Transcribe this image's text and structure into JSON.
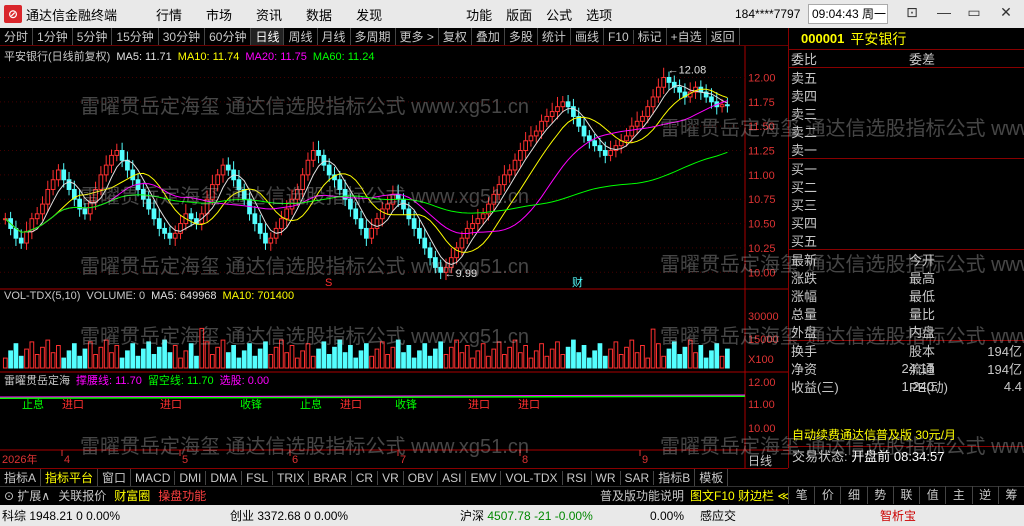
{
  "titlebar": {
    "app_name": "通达信金融终端",
    "menu": [
      "行情",
      "市场",
      "资讯",
      "数据",
      "发现"
    ],
    "menu2": [
      "功能",
      "版面",
      "公式",
      "选项"
    ],
    "user": "184****7797",
    "clock": "09:04:43 周一",
    "win_btns": [
      "⊡",
      "—",
      "▭",
      "✕"
    ]
  },
  "toolbar": {
    "items": [
      "分时",
      "1分钟",
      "5分钟",
      "15分钟",
      "30分钟",
      "60分钟",
      "日线",
      "周线",
      "月线",
      "多周期",
      "更多 >",
      "复权",
      "叠加",
      "多股",
      "统计",
      "画线",
      "F10",
      "标记",
      "+自选",
      "返回"
    ],
    "active": "日线"
  },
  "main_legend": {
    "title": "平安银行(日线前复权)",
    "items": [
      {
        "text": "MA5: 11.71",
        "color": "#e0e0e0"
      },
      {
        "text": "MA10: 11.74",
        "color": "#ffff00"
      },
      {
        "text": "MA20: 11.75",
        "color": "#ff00ff"
      },
      {
        "text": "MA60: 11.24",
        "color": "#00ff00"
      }
    ]
  },
  "vol_legend": {
    "title": "VOL-TDX(5,10)",
    "items": [
      {
        "text": "VOLUME: 0",
        "color": "#c8c8c8"
      },
      {
        "text": "MA5: 649968",
        "color": "#e0e0e0"
      },
      {
        "text": "MA10: 701400",
        "color": "#ffff00"
      }
    ]
  },
  "ind_legend": {
    "title": "雷曜贯岳定海",
    "items": [
      {
        "text": "撑腰线: 11.70",
        "color": "#ff00ff"
      },
      {
        "text": "留空线: 11.70",
        "color": "#00ff00"
      },
      {
        "text": "选股: 0.00",
        "color": "#ff00ff"
      }
    ]
  },
  "price_axis": [
    "12.00",
    "11.75",
    "11.50",
    "11.25",
    "11.00",
    "10.75",
    "10.50",
    "10.25",
    "10.00"
  ],
  "vol_axis": [
    "30000",
    "15000",
    "X100"
  ],
  "ind_axis": [
    "12.00",
    "11.00",
    "10.00"
  ],
  "annotations": {
    "high": "12.08",
    "low": "9.99",
    "s_mark": "S",
    "cai_mark": "财"
  },
  "date_axis": {
    "year": "2026年",
    "months": [
      "4",
      "5",
      "6",
      "7",
      "8",
      "9"
    ]
  },
  "ind_signals": {
    "zhi_xi": "止息",
    "jin_kou": "进口",
    "shou_feng": "收锋"
  },
  "chart_data": {
    "type": "candlestick",
    "title": "平安银行(日线前复权)",
    "ylim": [
      9.9,
      12.2
    ],
    "close": [
      10.55,
      10.45,
      10.35,
      10.3,
      10.42,
      10.55,
      10.6,
      10.7,
      10.85,
      10.95,
      11.05,
      10.95,
      10.85,
      10.75,
      10.65,
      10.6,
      10.72,
      10.85,
      11.0,
      11.1,
      11.2,
      11.25,
      11.15,
      11.05,
      10.95,
      10.85,
      10.75,
      10.65,
      10.55,
      10.45,
      10.4,
      10.35,
      10.4,
      10.5,
      10.6,
      10.55,
      10.5,
      10.6,
      10.75,
      10.9,
      11.0,
      11.1,
      11.05,
      10.95,
      10.85,
      10.75,
      10.6,
      10.5,
      10.4,
      10.3,
      10.35,
      10.45,
      10.55,
      10.65,
      10.75,
      10.85,
      11.0,
      11.15,
      11.25,
      11.2,
      11.1,
      11.0,
      10.95,
      10.85,
      10.75,
      10.65,
      10.55,
      10.45,
      10.35,
      10.45,
      10.55,
      10.65,
      10.7,
      10.8,
      10.75,
      10.65,
      10.55,
      10.45,
      10.35,
      10.25,
      10.15,
      10.05,
      10.0,
      10.05,
      10.15,
      10.25,
      10.35,
      10.45,
      10.5,
      10.55,
      10.6,
      10.7,
      10.8,
      10.9,
      11.0,
      11.05,
      11.15,
      11.25,
      11.35,
      11.4,
      11.45,
      11.55,
      11.6,
      11.65,
      11.7,
      11.75,
      11.7,
      11.6,
      11.5,
      11.4,
      11.35,
      11.3,
      11.25,
      11.2,
      11.25,
      11.3,
      11.35,
      11.4,
      11.5,
      11.55,
      11.6,
      11.7,
      11.8,
      11.9,
      12.0,
      11.95,
      11.9,
      11.85,
      11.8,
      11.85,
      11.9,
      11.85,
      11.8,
      11.75,
      11.7,
      11.72,
      11.71
    ],
    "vol_ma5_last": 649968,
    "vol_ma10_last": 701400
  },
  "right_panel": {
    "code": "000001",
    "name": "平安银行",
    "row1": {
      "lbl": "委比",
      "lbl2": "委差"
    },
    "sell": [
      "卖五",
      "卖四",
      "卖三",
      "卖二",
      "卖一"
    ],
    "buy": [
      "买一",
      "买二",
      "买三",
      "买四",
      "买五"
    ],
    "info": [
      {
        "l": "最新",
        "l2": "今开"
      },
      {
        "l": "涨跌",
        "l2": "最高"
      },
      {
        "l": "涨幅",
        "l2": "最低"
      },
      {
        "l": "总量",
        "l2": "量比"
      },
      {
        "l": "外盘",
        "l2": "内盘"
      }
    ],
    "fin": [
      {
        "l": "换手",
        "l2": "股本",
        "v2": "194亿"
      },
      {
        "l": "净资",
        "v": "24.13",
        "l2": "流通",
        "v2": "194亿"
      },
      {
        "l": "收益(三)",
        "v": "1.240",
        "l2": "PE(动)",
        "v2": "4.4"
      }
    ],
    "ad": "自动续费通达信普及版 30元/月",
    "status_label": "交易状态:",
    "status_value": "开盘前 08:34:57",
    "buttons": [
      "笔",
      "价",
      "细",
      "势",
      "联",
      "值",
      "主",
      "逆",
      "筹"
    ]
  },
  "tabs1": {
    "items": [
      "指标A",
      "指标平台",
      "窗口",
      "MACD",
      "DMI",
      "DMA",
      "FSL",
      "TRIX",
      "BRAR",
      "CR",
      "VR",
      "OBV",
      "ASI",
      "EMV",
      "VOL-TDX",
      "RSI",
      "WR",
      "SAR",
      "指标B",
      "模板"
    ],
    "active": "指标平台",
    "right_tab": "日线"
  },
  "tabs2": {
    "expand": "扩展∧",
    "items": [
      {
        "text": "关联报价",
        "color": "#c8c8c8"
      },
      {
        "text": "财富圈",
        "color": "#ffff00"
      },
      {
        "text": "操盘功能",
        "color": "#ff4040"
      }
    ],
    "right": "普及版功能说明",
    "f10": "图文F10 财边栏 ≪"
  },
  "statusbar": {
    "items": [
      {
        "name": "科综",
        "value": "1948.21",
        "chg": "0",
        "pct": "0.00%"
      },
      {
        "name": "创业",
        "value": "3372.68",
        "chg": "0",
        "pct": "0.00%"
      },
      {
        "name": "沪深",
        "value": "4507.78",
        "chg": "-21",
        "pct": "-0.00%"
      }
    ],
    "extra": "0.00%",
    "zhike": "智析宝",
    "right": "感应交"
  },
  "watermark": "雷曜贯岳定海玺 通达信选股指标公式 www.xg51.cn"
}
